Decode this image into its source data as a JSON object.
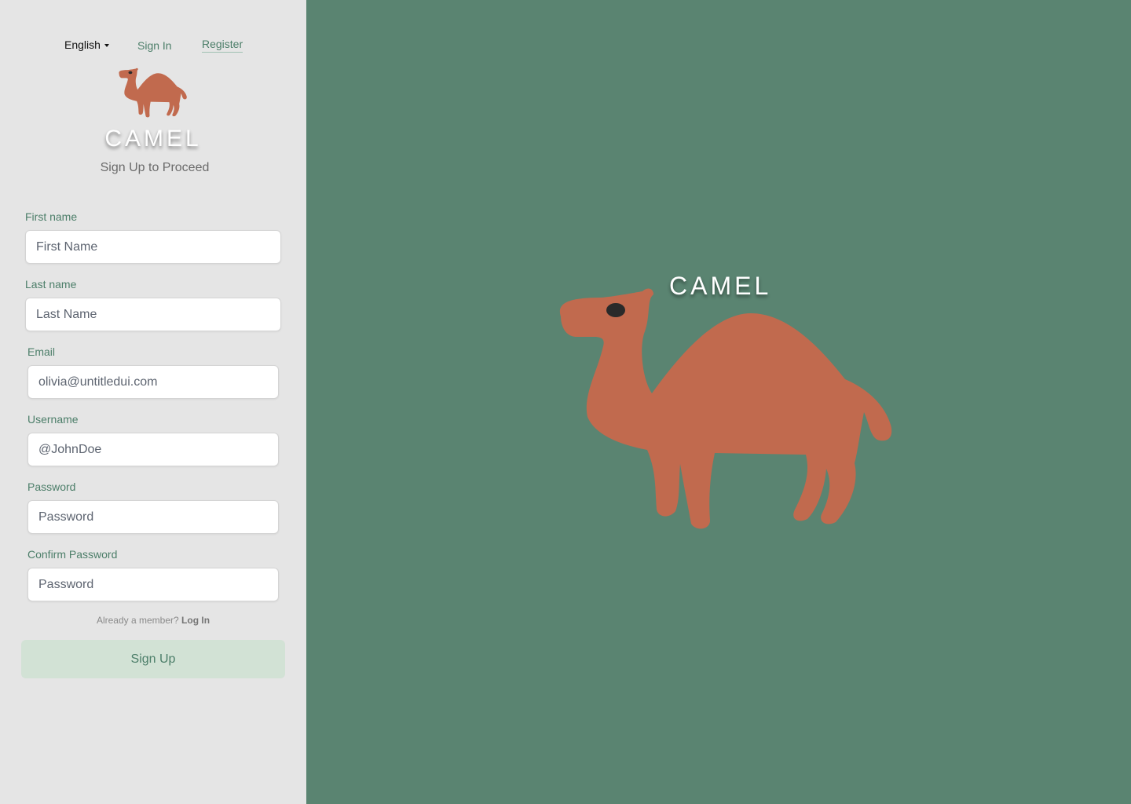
{
  "nav": {
    "language": "English",
    "sign_in": "Sign In",
    "register": "Register"
  },
  "brand": {
    "name": "CAMEL",
    "subtitle": "Sign Up to Proceed",
    "logo_icon": "camel-icon",
    "camel_color": "#c16a4e",
    "panel_color": "#5a8471"
  },
  "form": {
    "first_name": {
      "label": "First name",
      "placeholder": "First Name"
    },
    "last_name": {
      "label": "Last name",
      "placeholder": "Last Name"
    },
    "email": {
      "label": "Email",
      "placeholder": "olivia@untitledui.com"
    },
    "username": {
      "label": "Username",
      "placeholder": "@JohnDoe"
    },
    "password": {
      "label": "Password",
      "placeholder": "Password"
    },
    "confirm_password": {
      "label": "Confirm Password",
      "placeholder": "Password"
    },
    "already_member": "Already a member?",
    "log_in": "Log In",
    "submit": "Sign Up"
  },
  "hero": {
    "title": "CAMEL"
  }
}
